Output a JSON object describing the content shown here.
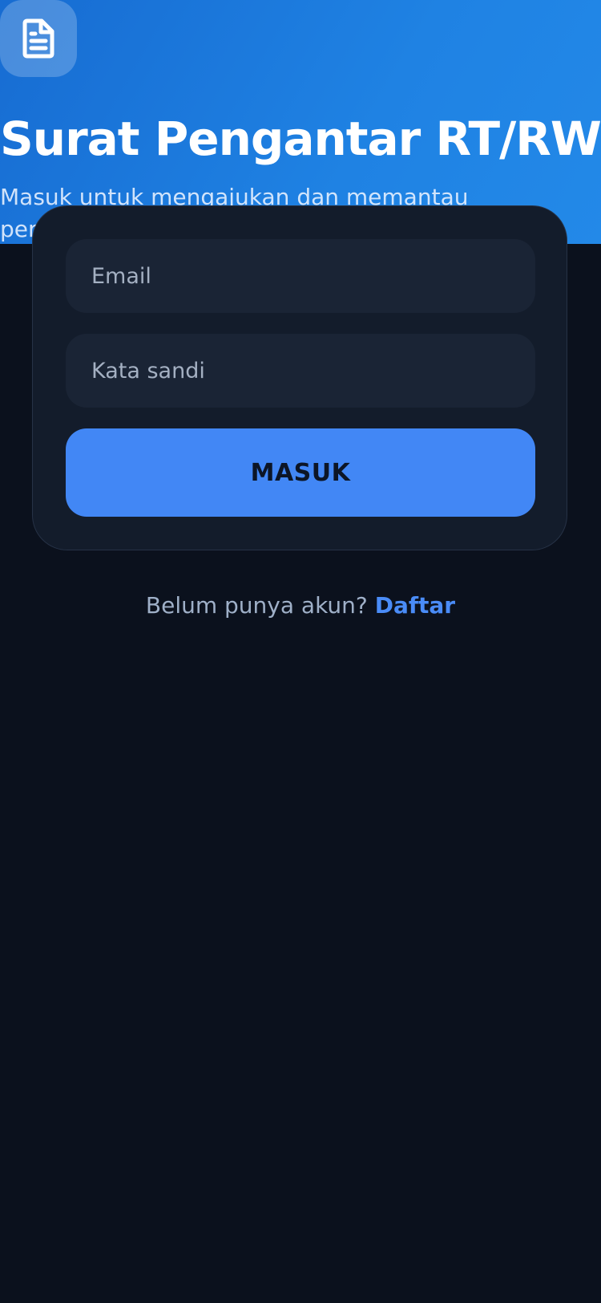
{
  "header": {
    "title": "Surat Pengantar RT/RW",
    "subtitle": "Masuk untuk mengajukan dan memantau permohonan surat",
    "icon": "document-icon"
  },
  "login_form": {
    "email_placeholder": "Email",
    "email_value": "",
    "password_placeholder": "Kata sandi",
    "password_value": "",
    "submit_label": "MASUK"
  },
  "register": {
    "prompt": "Belum punya akun?",
    "link_label": "Daftar"
  },
  "colors": {
    "header_gradient_start": "#176cd2",
    "header_gradient_end": "#2389e8",
    "background": "#0b111d",
    "card": "#131c2b",
    "accent": "#4287f5"
  }
}
